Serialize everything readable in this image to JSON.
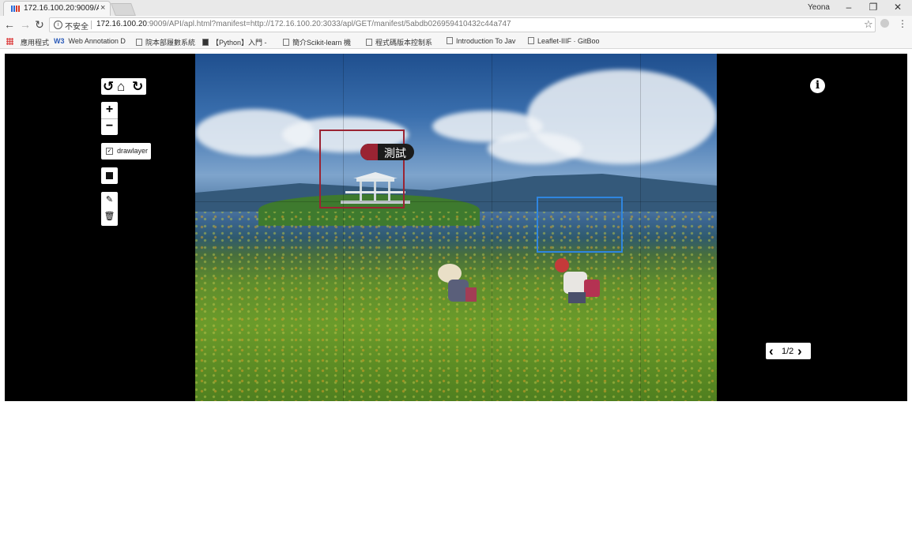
{
  "browser": {
    "tab_title": "172.16.100.20:9009/API",
    "tab_close": "×",
    "user_name": "Yeona",
    "window_controls": {
      "minimize": "–",
      "restore": "❐",
      "close": "✕"
    },
    "nav": {
      "back": "←",
      "forward": "→",
      "reload": "↻"
    },
    "security_label": "不安全",
    "url_host": "172.16.100.20",
    "url_rest": ":9009/API/apl.html?manifest=http://172.16.100.20:3033/apl/GET/manifest/5abdb026959410432c44a747",
    "star_icon": "☆",
    "menu_icon": "⋮"
  },
  "bookmarks": [
    {
      "label": "應用程式",
      "icon": "apps-icon"
    },
    {
      "label": "Web Annotation D",
      "icon": "w3-icon"
    },
    {
      "label": "院本部履數系統",
      "icon": "page-icon"
    },
    {
      "label": "【Python】入門 -",
      "icon": "e-icon"
    },
    {
      "label": "簡介Scikit-learn 機",
      "icon": "book-icon"
    },
    {
      "label": "程式碼版本控制系",
      "icon": "page-icon"
    },
    {
      "label": "Introduction To Jav",
      "icon": "doc-icon"
    },
    {
      "label": "Leaflet-IIIF · GitBoo",
      "icon": "book-icon"
    }
  ],
  "viewer": {
    "toolbar": {
      "rotate_left": "↺",
      "home": "⌂",
      "rotate_right": "↻"
    },
    "zoom_in": "+",
    "zoom_out": "−",
    "layer": {
      "checked": "✓",
      "label": "drawlayer"
    },
    "edit_icon": "✎",
    "delete_icon": "🗑",
    "info_icon": "i",
    "annotation_tooltip": "測試",
    "pager": {
      "prev": "‹",
      "next": "›",
      "page": "1/2"
    },
    "colors": {
      "annotation_red": "#9a2433",
      "annotation_blue": "#2f86e0"
    }
  }
}
